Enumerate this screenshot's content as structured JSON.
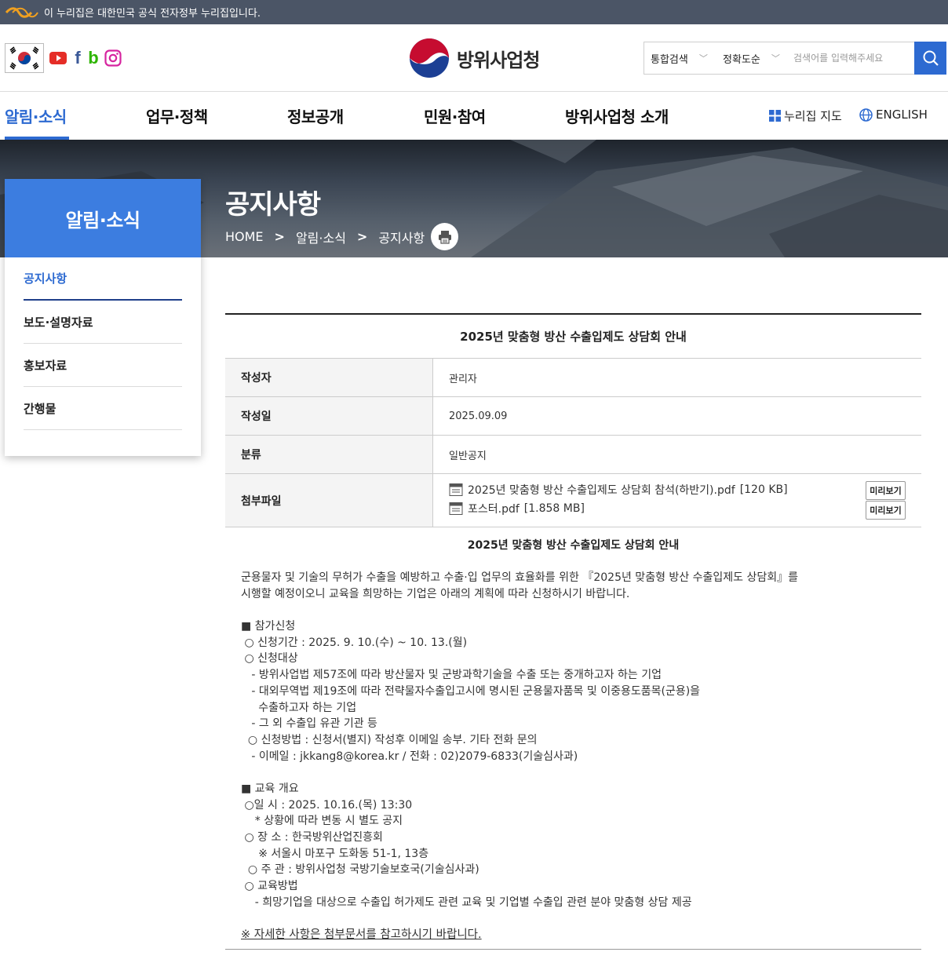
{
  "gov_banner": {
    "text": "이 누리집은 대한민국 공식 전자정부 누리집입니다."
  },
  "header": {
    "logo_text": "방위사업청",
    "search": {
      "scope": "통합검색",
      "sort": "정확도순",
      "placeholder": "검색어를 입력해주세요"
    }
  },
  "gnb": {
    "menus": [
      "알림·소식",
      "업무·정책",
      "정보공개",
      "민원·참여",
      "방위사업청 소개"
    ],
    "util": {
      "sitemap": "누리집 지도",
      "english": "ENGLISH"
    }
  },
  "visual": {
    "title": "공지사항",
    "breadcrumb": [
      "HOME",
      "알림·소식",
      "공지사항"
    ]
  },
  "lnb": {
    "title": "알림·소식",
    "items": [
      "공지사항",
      "보도·설명자료",
      "홍보자료",
      "간행물"
    ]
  },
  "post": {
    "title": "2025년 맞춤형 방산 수출입제도 상담회 안내",
    "labels": {
      "author": "작성자",
      "date": "작성일",
      "category": "분류",
      "files": "첨부파일"
    },
    "author": "관리자",
    "date": "2025.09.09",
    "category": "일반공지",
    "files": [
      {
        "name": "2025년 맞춤형 방산 수출입제도 상담회 참석(하반기).pdf",
        "size": "[120 KB]",
        "preview": "미리보기"
      },
      {
        "name": "포스터.pdf",
        "size": "[1.858 MB]",
        "preview": "미리보기"
      }
    ],
    "body_title": "2025년 맞춤형 방산 수출입제도 상담회 안내",
    "body_lines": [
      "군용물자 및 기술의 무허가 수출을 예방하고 수출·입 업무의 효율화를 위한 『2025년 맞춤형 방산 수출입제도 상담회』를",
      "시행할 예정이오니 교육을 희망하는 기업은 아래의 계획에 따라 신청하시기 바랍니다.",
      "",
      "■ 참가신청",
      " ○ 신청기간 : 2025. 9. 10.(수) ~ 10. 13.(월)",
      " ○ 신청대상",
      "   - 방위사업법 제57조에 따라 방산물자 및 군방과학기술을 수출 또는 중개하고자 하는 기업",
      "   - 대외무역법 제19조에 따라 전략물자수출입고시에 명시된 군용물자품목 및 이중용도품목(군용)을",
      "     수출하고자 하는 기업",
      "   - 그 외 수출입 유관 기관 등",
      "  ○ 신청방법 : 신청서(별지) 작성후 이메일 송부. 기타 전화 문의",
      "   - 이메일 : jkkang8@korea.kr / 전화 : 02)2079-6833(기술심사과)",
      "",
      "■ 교육 개요",
      " ○일 시 : 2025. 10.16.(목) 13:30",
      "    * 상황에 따라 변동 시 별도 공지",
      " ○ 장 소 : 한국방위산업진흥회",
      "     ※ 서울시 마포구 도화동 51-1, 13층",
      "  ○ 주 관 : 방위사업청 국방기술보호국(기술심사과)",
      " ○ 교육방법",
      "    - 희망기업을 대상으로 수출입 허가제도 관련 교육 및 기업별 수출입 관련 분야 맞춤형 상담 제공"
    ],
    "closing": "※ 자세한 사항은 첨부문서를 참고하시기 바랍니다."
  },
  "colors": {
    "primary": "#2d6ad1",
    "lnb_title_bg": "#3c7de0",
    "gov_bar": "#4b5566"
  }
}
